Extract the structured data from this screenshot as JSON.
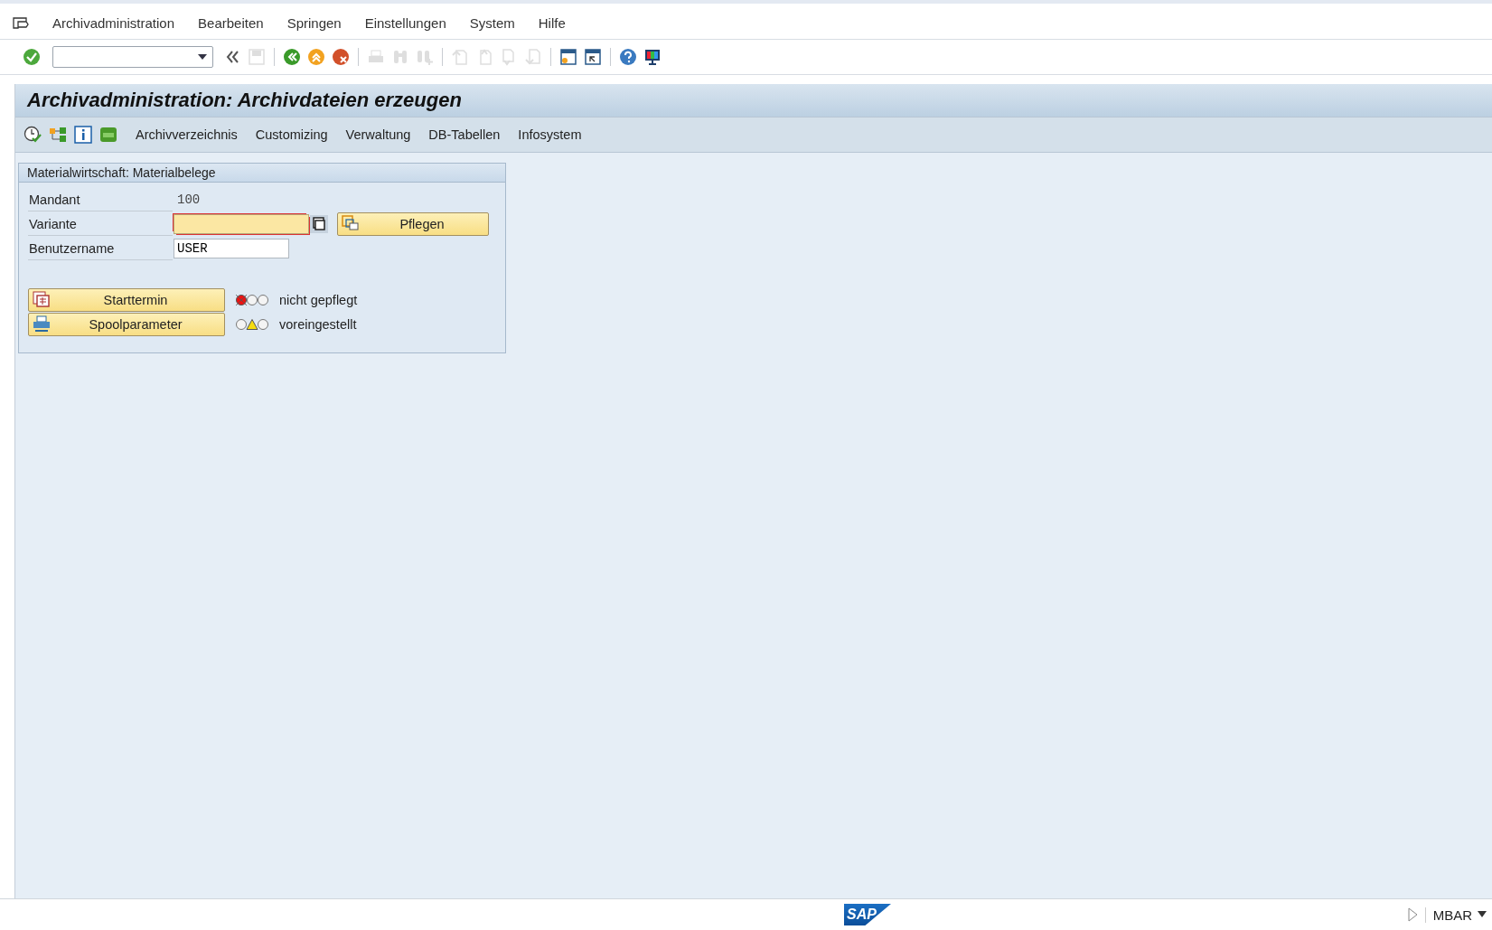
{
  "menu_bar": {
    "items": [
      "Archivadministration",
      "Bearbeiten",
      "Springen",
      "Einstellungen",
      "System",
      "Hilfe"
    ]
  },
  "toolbar": {
    "buttons": [
      {
        "kind": "enter",
        "disabled": false
      },
      {
        "kind": "combo"
      },
      {
        "kind": "collapse"
      },
      {
        "kind": "save",
        "disabled": true
      },
      {
        "kind": "sep"
      },
      {
        "kind": "back",
        "disabled": false
      },
      {
        "kind": "exit",
        "disabled": false
      },
      {
        "kind": "cancel",
        "disabled": false
      },
      {
        "kind": "sep"
      },
      {
        "kind": "print",
        "disabled": true
      },
      {
        "kind": "find",
        "disabled": true
      },
      {
        "kind": "findnext",
        "disabled": true
      },
      {
        "kind": "sep"
      },
      {
        "kind": "first",
        "disabled": true
      },
      {
        "kind": "prev",
        "disabled": true
      },
      {
        "kind": "next",
        "disabled": true
      },
      {
        "kind": "last",
        "disabled": true
      },
      {
        "kind": "sep"
      },
      {
        "kind": "newsession",
        "disabled": false
      },
      {
        "kind": "shortcut",
        "disabled": false
      },
      {
        "kind": "sep"
      },
      {
        "kind": "help",
        "disabled": false
      },
      {
        "kind": "layout",
        "disabled": false
      }
    ]
  },
  "title": "Archivadministration: Archivdateien erzeugen",
  "app_toolbar": {
    "items": [
      "Archivverzeichnis",
      "Customizing",
      "Verwaltung",
      "DB-Tabellen",
      "Infosystem"
    ]
  },
  "group": {
    "title": "Materialwirtschaft: Materialbelege",
    "fields": [
      {
        "label": "Mandant",
        "kind": "display",
        "value": "100"
      },
      {
        "label": "Variante",
        "kind": "required",
        "button": "Pflegen"
      },
      {
        "label": "Benutzername",
        "kind": "input",
        "value": "USER"
      }
    ],
    "actions": [
      {
        "button": {
          "kind": "calendar",
          "label": "Starttermin"
        },
        "status": {
          "kind": "red",
          "text": "nicht gepflegt"
        }
      },
      {
        "button": {
          "kind": "printer",
          "label": "Spoolparameter"
        },
        "status": {
          "kind": "yellow",
          "text": "voreingestellt"
        }
      }
    ]
  },
  "status_bar": {
    "logo": "SAP",
    "system": "MBAR"
  }
}
